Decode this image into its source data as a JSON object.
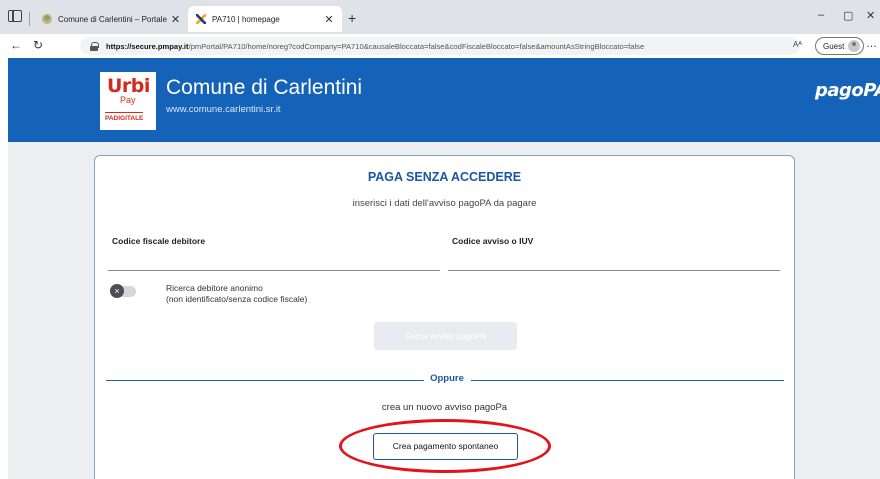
{
  "browser": {
    "tabs": [
      {
        "title": "Comune di Carlentini – Portale ist",
        "favicon": "town-crest-icon",
        "active": false
      },
      {
        "title": "PA710 | homepage",
        "favicon": "pagopa-icon",
        "active": true
      }
    ],
    "new_tab_label": "+",
    "url_host": "https://secure.pmpay.it",
    "url_path": "/pmPortal/PA710/home/noreg?codCompany=PA710&causaleBloccata=false&codFiscaleBloccato=false&amountAsStringBloccato=false",
    "reader_label": "Aᴬ",
    "profile_label": "Guest"
  },
  "header": {
    "logo_line1": "Urbi",
    "logo_line2": "Pay",
    "logo_line3": "PADIGITALE",
    "site_name": "Comune di Carlentini",
    "site_url": "www.comune.carlentini.sr.it",
    "pagopa_logo": "pagoPA",
    "background_color": "#1563b8"
  },
  "form": {
    "title": "PAGA SENZA ACCEDERE",
    "subtitle": "inserisci i dati dell'avviso pagoPA da pagare",
    "fields": [
      {
        "label": "Codice fiscale debitore",
        "value": ""
      },
      {
        "label": "Codice avviso o IUV",
        "value": ""
      }
    ],
    "anon_toggle": {
      "label_line1": "Ricerca debitore anonimo",
      "label_line2": "(non identificato/senza codice fiscale)",
      "checked": false
    },
    "search_button": "Cerca avviso pagoPA",
    "separator": "Oppure",
    "create_text": "crea un nuovo avviso pagoPa",
    "spontaneous_button": "Crea pagamento spontaneo"
  },
  "colors": {
    "accent": "#1b56a6",
    "highlight": "#e3121b"
  }
}
